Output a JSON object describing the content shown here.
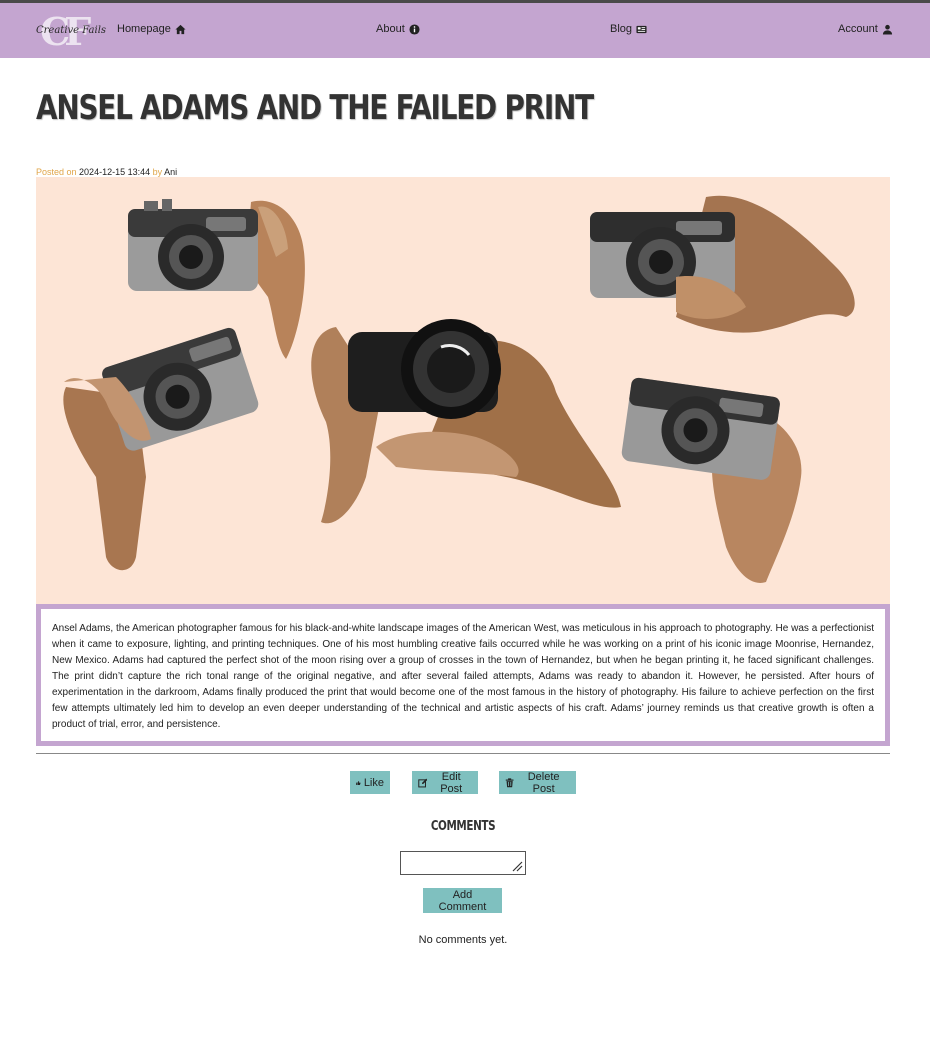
{
  "nav": {
    "logo_letters": "CF",
    "logo_script": "Creative Fails",
    "home": "Homepage",
    "about": "About",
    "blog": "Blog",
    "account": "Account"
  },
  "post": {
    "title": "Ansel Adams and the Failed Print",
    "posted_on_label": "Posted on",
    "date": "2024-12-15 13:44",
    "by_label": "by",
    "author": "Ani",
    "body": "Ansel Adams, the American photographer famous for his black-and-white landscape images of the American West, was meticulous in his approach to photography. He was a perfectionist when it came to exposure, lighting, and printing techniques. One of his most humbling creative fails occurred while he was working on a print of his iconic image Moonrise, Hernandez, New Mexico. Adams had captured the perfect shot of the moon rising over a group of crosses in the town of Hernandez, but when he began printing it, he faced significant challenges. The print didn’t capture the rich tonal range of the original negative, and after several failed attempts, Adams was ready to abandon it. However, he persisted. After hours of experimentation in the darkroom, Adams finally produced the print that would become one of the most famous in the history of photography. His failure to achieve perfection on the first few attempts ultimately led him to develop an even deeper understanding of the technical and artistic aspects of his craft. Adams’ journey reminds us that creative growth is often a product of trial, error, and persistence."
  },
  "actions": {
    "like": "Like",
    "edit": "Edit Post",
    "delete": "Delete Post"
  },
  "comments": {
    "heading": "COMMENTS",
    "input_value": "",
    "add_button": "Add Comment",
    "empty": "No comments yet."
  },
  "colors": {
    "navbar": "#c4a5d0",
    "button": "#7fc0bf",
    "hero_bg": "#fde5d6",
    "meta_accent": "#e0a64a"
  },
  "icons": {
    "home": "home-icon",
    "about": "info-circle-icon",
    "blog": "newspaper-icon",
    "account": "user-icon",
    "like": "thumbs-up-icon",
    "edit": "edit-icon",
    "delete": "trash-icon"
  }
}
